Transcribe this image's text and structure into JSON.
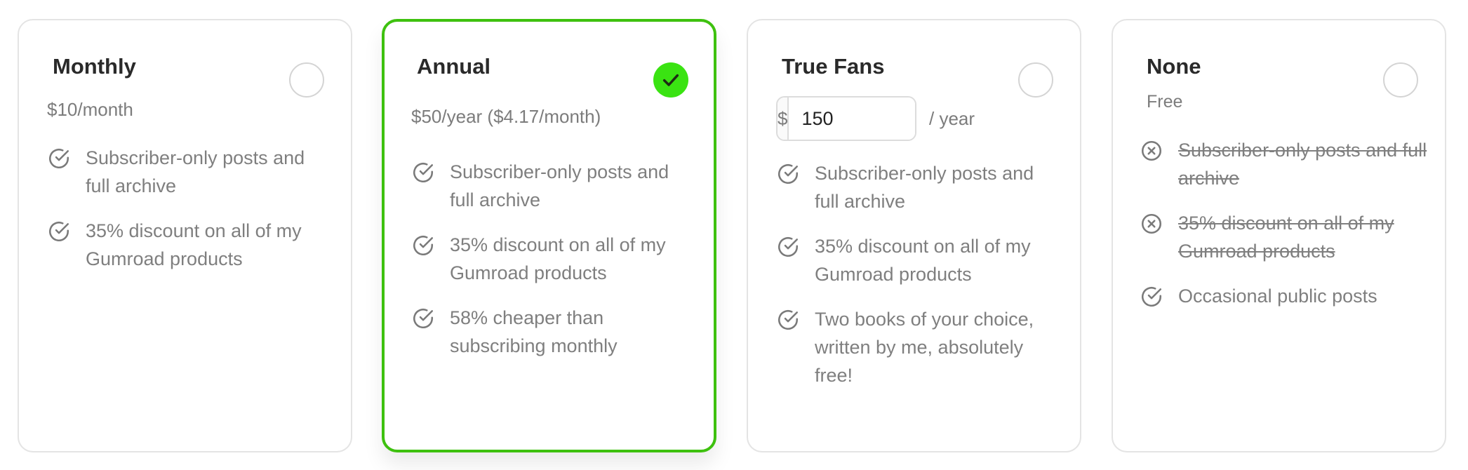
{
  "plans": [
    {
      "title": "Monthly",
      "price": "$10/month",
      "selected": false,
      "features": [
        {
          "text": "Subscriber-only posts and full archive",
          "included": true
        },
        {
          "text": "35% discount on all of my Gumroad products",
          "included": true
        }
      ]
    },
    {
      "title": "Annual",
      "price": "$50/year ($4.17/month)",
      "selected": true,
      "features": [
        {
          "text": "Subscriber-only posts and full archive",
          "included": true
        },
        {
          "text": "35% discount on all of my Gumroad products",
          "included": true
        },
        {
          "text": "58% cheaper than subscribing monthly",
          "included": true
        }
      ]
    },
    {
      "title": "True Fans",
      "price_input": {
        "currency": "$",
        "value": "150",
        "period": "/ year"
      },
      "selected": false,
      "features": [
        {
          "text": "Subscriber-only posts and full archive",
          "included": true
        },
        {
          "text": "35% discount on all of my Gumroad products",
          "included": true
        },
        {
          "text": "Two books of your choice, written by me, absolutely free!",
          "included": true
        }
      ]
    },
    {
      "title": "None",
      "price": "Free",
      "selected": false,
      "features": [
        {
          "text": "Subscriber-only posts and full archive",
          "included": false
        },
        {
          "text": "35% discount on all of my Gumroad products",
          "included": false
        },
        {
          "text": "Occasional public posts",
          "included": true
        }
      ]
    }
  ],
  "icons": {
    "included": "check-circle-icon",
    "excluded": "x-circle-icon",
    "selected": "checkmark-icon"
  },
  "colors": {
    "selected_border": "#3ec10f",
    "selected_fill": "#3ae312",
    "muted_text": "#7f7f7f",
    "title_text": "#2a2a2a"
  }
}
